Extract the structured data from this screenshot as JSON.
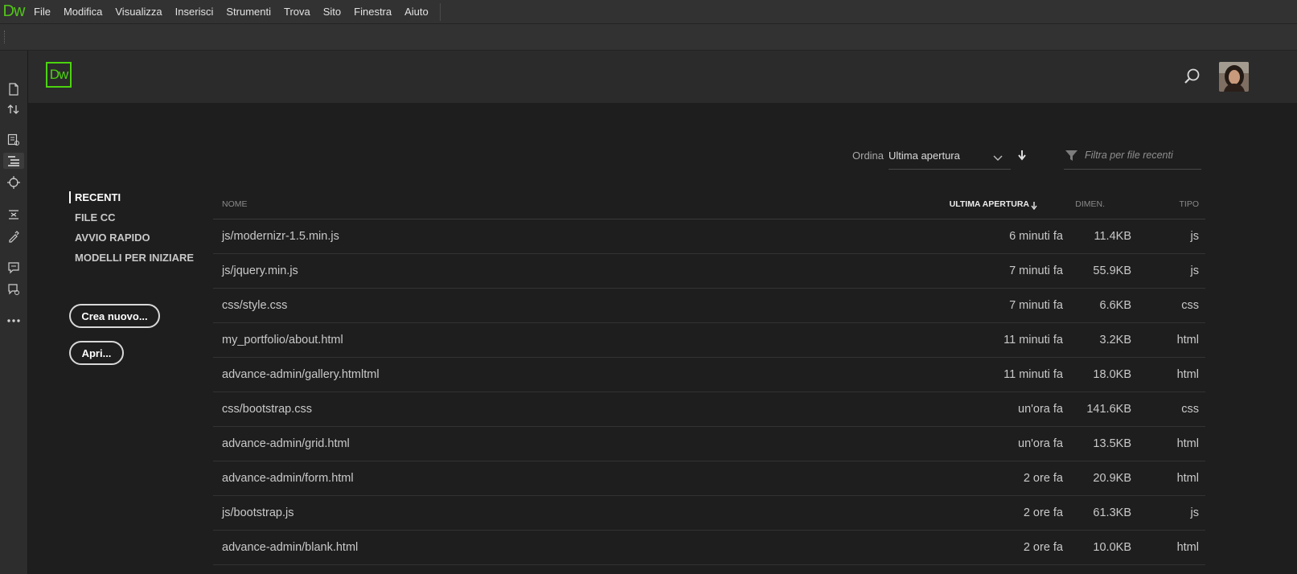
{
  "app": {
    "logo": "Dw",
    "accent": "#4cd40f"
  },
  "menubar": {
    "items": [
      "File",
      "Modifica",
      "Visualizza",
      "Inserisci",
      "Strumenti",
      "Trova",
      "Sito",
      "Finestra",
      "Aiuto"
    ]
  },
  "header": {
    "logo": "Dw",
    "search_icon": "search-icon",
    "avatar": "user-avatar"
  },
  "sort": {
    "label": "Ordina",
    "value": "Ultima apertura"
  },
  "filter": {
    "placeholder": "Filtra per file recenti"
  },
  "nav": {
    "items": [
      "RECENTI",
      "FILE CC",
      "AVVIO RAPIDO",
      "MODELLI PER INIZIARE"
    ]
  },
  "buttons": {
    "new": "Crea nuovo...",
    "open": "Apri..."
  },
  "table": {
    "headers": {
      "name": "NOME",
      "last_opened": "ULTIMA APERTURA",
      "size": "DIMEN.",
      "type": "TIPO"
    },
    "rows": [
      {
        "name": "js/modernizr-1.5.min.js",
        "time": "6 minuti fa",
        "size": "11.4KB",
        "type": "js"
      },
      {
        "name": "js/jquery.min.js",
        "time": "7 minuti fa",
        "size": "55.9KB",
        "type": "js"
      },
      {
        "name": "css/style.css",
        "time": "7 minuti fa",
        "size": "6.6KB",
        "type": "css"
      },
      {
        "name": "my_portfolio/about.html",
        "time": "11 minuti fa",
        "size": "3.2KB",
        "type": "html"
      },
      {
        "name": "advance-admin/gallery.htmltml",
        "time": "11 minuti fa",
        "size": "18.0KB",
        "type": "html"
      },
      {
        "name": "css/bootstrap.css",
        "time": "un'ora fa",
        "size": "141.6KB",
        "type": "css"
      },
      {
        "name": "advance-admin/grid.html",
        "time": "un'ora fa",
        "size": "13.5KB",
        "type": "html"
      },
      {
        "name": "advance-admin/form.html",
        "time": "2 ore fa",
        "size": "20.9KB",
        "type": "html"
      },
      {
        "name": "js/bootstrap.js",
        "time": "2 ore fa",
        "size": "61.3KB",
        "type": "js"
      },
      {
        "name": "advance-admin/blank.html",
        "time": "2 ore fa",
        "size": "10.0KB",
        "type": "html"
      }
    ]
  }
}
